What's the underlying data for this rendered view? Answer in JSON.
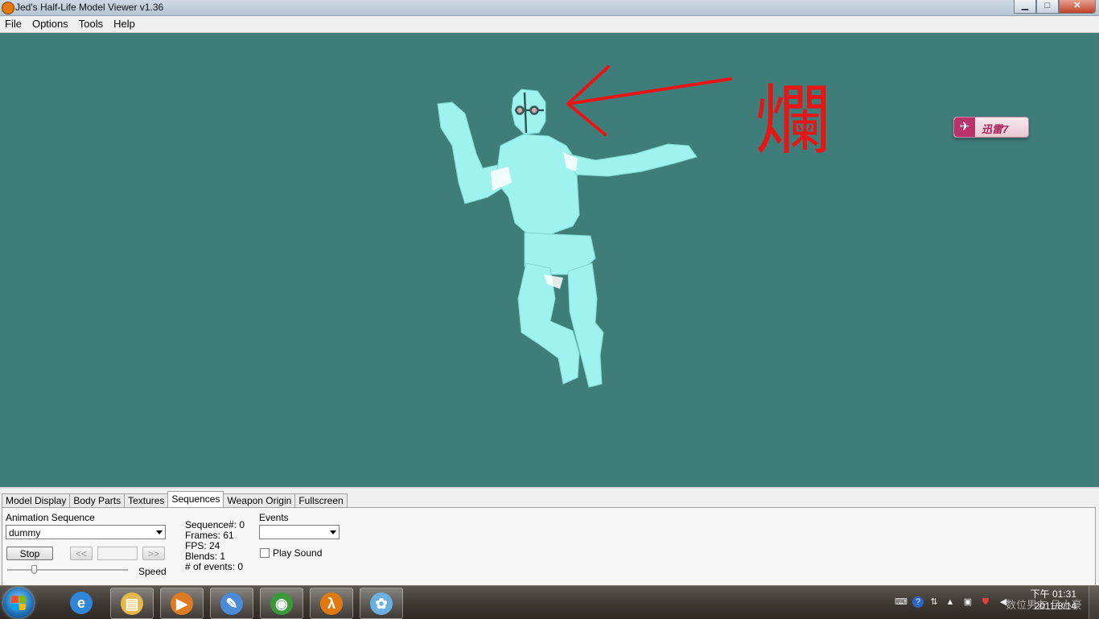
{
  "window": {
    "title": "Jed's Half-Life Model Viewer v1.36",
    "buttons": {
      "minimize": "▁",
      "maximize": "□",
      "close": "✕"
    }
  },
  "menu": [
    "File",
    "Options",
    "Tools",
    "Help"
  ],
  "viewport": {
    "annotation_char": "爛",
    "badge_text": "迅雷7",
    "background_color": "#3f7d7b"
  },
  "tabs": [
    "Model Display",
    "Body Parts",
    "Textures",
    "Sequences",
    "Weapon Origin",
    "Fullscreen"
  ],
  "active_tab": "Sequences",
  "sequences": {
    "animation_label": "Animation Sequence",
    "animation_value": "dummy",
    "stop_label": "Stop",
    "prev_label": "<<",
    "next_label": ">>",
    "speed_label": "Speed",
    "speed_level": 0.22,
    "info": {
      "sequence": "Sequence#: 0",
      "frames": "Frames: 61",
      "fps": "FPS: 24",
      "blends": "Blends: 1",
      "events": "# of events: 0"
    },
    "events_label": "Events",
    "events_value": "",
    "play_sound_label": "Play Sound",
    "play_sound_checked": false
  },
  "taskbar": {
    "apps": [
      {
        "name": "internet-explorer",
        "glyph": "e",
        "color": "#2f86d8"
      },
      {
        "name": "file-explorer",
        "glyph": "▤",
        "color": "#e5b84a"
      },
      {
        "name": "media-player",
        "glyph": "▶",
        "color": "#e07a20"
      },
      {
        "name": "paint-brush",
        "glyph": "✎",
        "color": "#4a8ad8"
      },
      {
        "name": "chrome",
        "glyph": "◉",
        "color": "#3a9a3a"
      },
      {
        "name": "half-life",
        "glyph": "λ",
        "color": "#e07a10"
      },
      {
        "name": "paint",
        "glyph": "✿",
        "color": "#6ab0e0"
      }
    ],
    "clock_time": "下午 01:31",
    "clock_date": "2011/8/14",
    "watermark": "数位男友 吕小豪"
  }
}
